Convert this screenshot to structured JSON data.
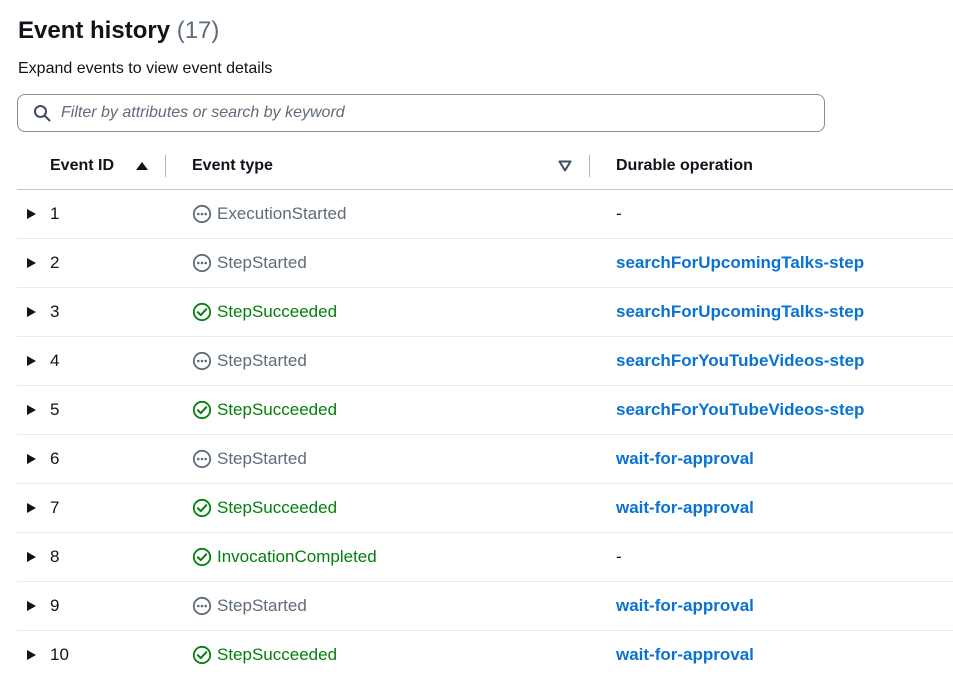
{
  "header": {
    "title": "Event history",
    "count": "(17)",
    "subtitle": "Expand events to view event details"
  },
  "search": {
    "placeholder": "Filter by attributes or search by keyword",
    "icon": "search-icon"
  },
  "table": {
    "columns": {
      "id": "Event ID",
      "type": "Event type",
      "operation": "Durable operation"
    },
    "rows": [
      {
        "id": "1",
        "type": "ExecutionStarted",
        "status": "pending",
        "operation": "-"
      },
      {
        "id": "2",
        "type": "StepStarted",
        "status": "pending",
        "operation": "searchForUpcomingTalks-step"
      },
      {
        "id": "3",
        "type": "StepSucceeded",
        "status": "success",
        "operation": "searchForUpcomingTalks-step"
      },
      {
        "id": "4",
        "type": "StepStarted",
        "status": "pending",
        "operation": "searchForYouTubeVideos-step"
      },
      {
        "id": "5",
        "type": "StepSucceeded",
        "status": "success",
        "operation": "searchForYouTubeVideos-step"
      },
      {
        "id": "6",
        "type": "StepStarted",
        "status": "pending",
        "operation": "wait-for-approval"
      },
      {
        "id": "7",
        "type": "StepSucceeded",
        "status": "success",
        "operation": "wait-for-approval"
      },
      {
        "id": "8",
        "type": "InvocationCompleted",
        "status": "success",
        "operation": "-"
      },
      {
        "id": "9",
        "type": "StepStarted",
        "status": "pending",
        "operation": "wait-for-approval"
      },
      {
        "id": "10",
        "type": "StepSucceeded",
        "status": "success",
        "operation": "wait-for-approval"
      }
    ]
  },
  "colors": {
    "success": "#037f0c",
    "pending": "#5f6b7a",
    "link": "#0972d3"
  }
}
